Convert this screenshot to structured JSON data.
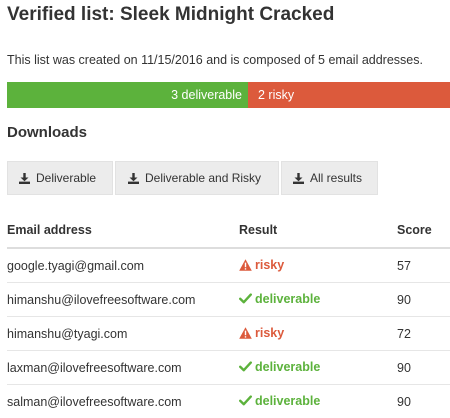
{
  "page": {
    "title": "Verified list: Sleek Midnight Cracked",
    "description": "This list was created on 11/15/2016 and is composed of 5 email addresses."
  },
  "summary_bar": {
    "deliverable_label": "3 deliverable",
    "risky_label": "2 risky",
    "deliverable_count": 3,
    "risky_count": 2,
    "deliverable_color": "#5cb23c",
    "risky_color": "#dc5a3c"
  },
  "downloads": {
    "heading": "Downloads",
    "buttons": [
      {
        "label": "Deliverable",
        "icon": "download-icon"
      },
      {
        "label": "Deliverable and Risky",
        "icon": "download-icon"
      },
      {
        "label": "All results",
        "icon": "download-icon"
      }
    ]
  },
  "table": {
    "headers": {
      "email": "Email address",
      "result": "Result",
      "score": "Score"
    },
    "rows": [
      {
        "email": "google.tyagi@gmail.com",
        "result": "risky",
        "score": "57",
        "icon": "warning-icon"
      },
      {
        "email": "himanshu@ilovefreesoftware.com",
        "result": "deliverable",
        "score": "90",
        "icon": "checkmark-icon"
      },
      {
        "email": "himanshu@tyagi.com",
        "result": "risky",
        "score": "72",
        "icon": "warning-icon"
      },
      {
        "email": "laxman@ilovefreesoftware.com",
        "result": "deliverable",
        "score": "90",
        "icon": "checkmark-icon"
      },
      {
        "email": "salman@ilovefreesoftware.com",
        "result": "deliverable",
        "score": "90",
        "icon": "checkmark-icon"
      }
    ]
  }
}
